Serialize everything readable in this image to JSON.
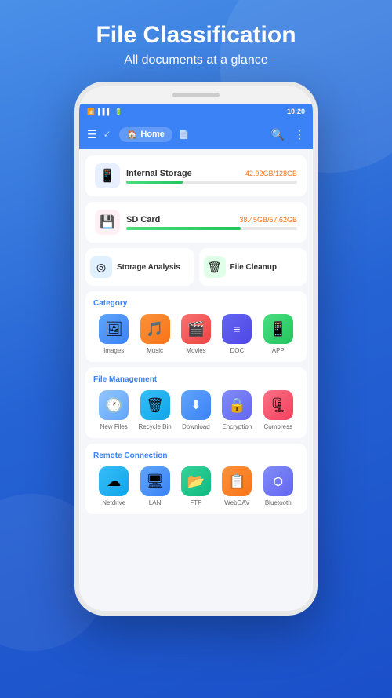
{
  "hero": {
    "title": "File Classification",
    "subtitle": "All documents at a glance"
  },
  "statusBar": {
    "time": "10:20",
    "icons": [
      "wifi",
      "signal",
      "battery"
    ]
  },
  "toolbar": {
    "homeLabel": "Home"
  },
  "storage": [
    {
      "name": "Internal Storage",
      "used": "42.92GB",
      "total": "128GB",
      "percent": 33,
      "icon": "📱",
      "iconClass": "storage-icon-internal"
    },
    {
      "name": "SD Card",
      "used": "38.45GB",
      "total": "57.62GB",
      "percent": 67,
      "icon": "💾",
      "iconClass": "storage-icon-sd"
    }
  ],
  "quickActions": [
    {
      "label": "Storage Analysis",
      "iconClass": "qa-icon-blue",
      "icon": "◎"
    },
    {
      "label": "File Cleanup",
      "iconClass": "qa-icon-green",
      "icon": "🗑"
    }
  ],
  "category": {
    "title": "Category",
    "items": [
      {
        "label": "Images",
        "icon": "🖼",
        "iconClass": "ib-blue"
      },
      {
        "label": "Music",
        "icon": "🎵",
        "iconClass": "ib-orange"
      },
      {
        "label": "Movies",
        "icon": "🎬",
        "iconClass": "ib-red"
      },
      {
        "label": "DOC",
        "icon": "≡",
        "iconClass": "ib-darkblue"
      },
      {
        "label": "APP",
        "icon": "📱",
        "iconClass": "ib-green"
      }
    ]
  },
  "fileManagement": {
    "title": "File Management",
    "items": [
      {
        "label": "New Files",
        "icon": "🕐",
        "iconClass": "ib-lightblue"
      },
      {
        "label": "Recycle Bin",
        "icon": "🗑",
        "iconClass": "ib-teal"
      },
      {
        "label": "Download",
        "icon": "⬇",
        "iconClass": "ib-blue"
      },
      {
        "label": "Encryption",
        "icon": "🔒",
        "iconClass": "ib-shield"
      },
      {
        "label": "Compress",
        "icon": "🗜",
        "iconClass": "ib-compress"
      }
    ]
  },
  "remoteConnection": {
    "title": "Remote Connection",
    "items": [
      {
        "label": "Netdrive",
        "icon": "☁",
        "iconClass": "ib-cloud"
      },
      {
        "label": "LAN",
        "icon": "🖥",
        "iconClass": "ib-lan"
      },
      {
        "label": "FTP",
        "icon": "📂",
        "iconClass": "ib-ftp"
      },
      {
        "label": "WebDAV",
        "icon": "📋",
        "iconClass": "ib-webdav"
      },
      {
        "label": "Bluetooth",
        "icon": "🔵",
        "iconClass": "ib-bt"
      }
    ]
  }
}
